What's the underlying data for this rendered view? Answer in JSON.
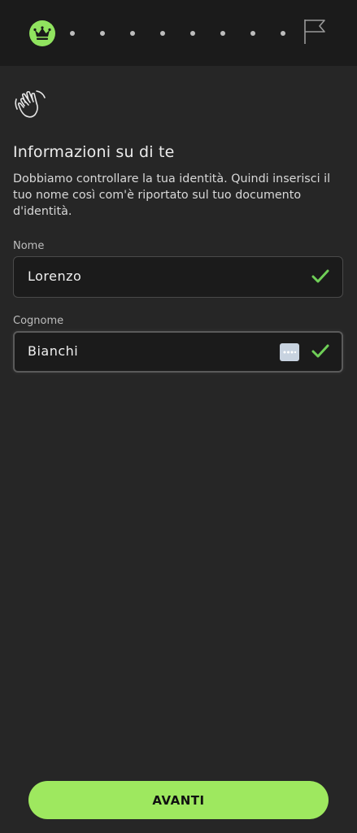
{
  "progress": {
    "total_steps": 9,
    "current_step": 1,
    "start_icon": "crown-icon",
    "end_icon": "flag-icon"
  },
  "intro": {
    "icon": "waving-hand-icon",
    "title": "Informazioni su di te",
    "description": "Dobbiamo controllare la tua identità. Quindi inserisci il tuo nome così com'è riportato sul tuo documento d'identità."
  },
  "form": {
    "first_name": {
      "label": "Nome",
      "value": "Lorenzo",
      "valid": true
    },
    "last_name": {
      "label": "Cognome",
      "value": "Bianchi",
      "valid": true,
      "autofill_icon": "autofill-key-icon"
    }
  },
  "footer": {
    "next_label": "AVANTI"
  },
  "colors": {
    "accent": "#9ee85f",
    "check": "#6fcf57",
    "background": "#262626",
    "header": "#1b1b1b"
  }
}
